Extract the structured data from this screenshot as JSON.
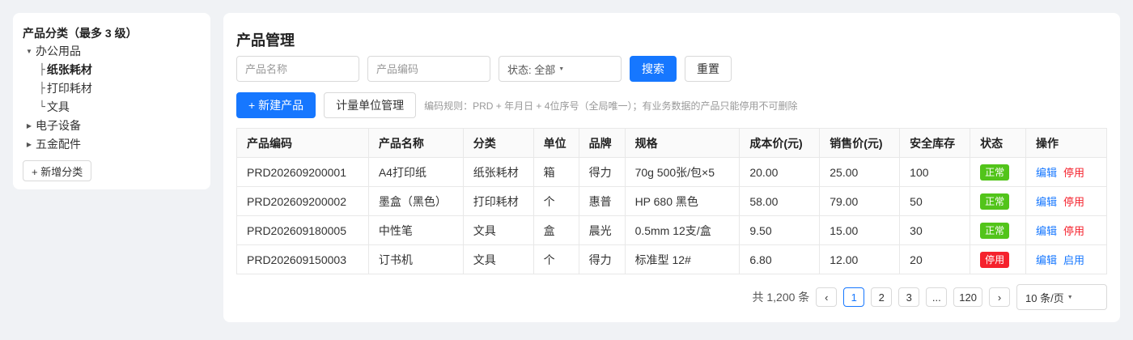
{
  "sidebar": {
    "title": "产品分类（最多 3 级）",
    "nodes": [
      {
        "label": "办公用品",
        "caret": "▼",
        "children": [
          {
            "branch": "├",
            "label": "纸张耗材"
          },
          {
            "branch": "├",
            "label": "打印耗材"
          },
          {
            "branch": "└",
            "label": "文具"
          }
        ]
      },
      {
        "label": "电子设备",
        "caret": "▶"
      },
      {
        "label": "五金配件",
        "caret": "▶"
      }
    ],
    "add_label": "+ 新增分类"
  },
  "main": {
    "title": "产品管理",
    "filters": {
      "name_placeholder": "产品名称",
      "code_placeholder": "产品编码",
      "status_label": "状态: 全部",
      "search_label": "搜索",
      "reset_label": "重置"
    },
    "actions": {
      "new_label": "+ 新建产品",
      "unit_label": "计量单位管理",
      "hint": "编码规则：PRD + 年月日 + 4位序号（全局唯一）；有业务数据的产品只能停用不可删除"
    },
    "table": {
      "headers": [
        "产品编码",
        "产品名称",
        "分类",
        "单位",
        "品牌",
        "规格",
        "成本价(元)",
        "销售价(元)",
        "安全库存",
        "状态",
        "操作"
      ],
      "rows": [
        {
          "code": "PRD202609200001",
          "name": "A4打印纸",
          "category": "纸张耗材",
          "unit": "箱",
          "brand": "得力",
          "spec": "70g 500张/包×5",
          "cost": "20.00",
          "price": "25.00",
          "stock": "100",
          "status": "正常",
          "edit": "编辑",
          "toggle": "停用"
        },
        {
          "code": "PRD202609200002",
          "name": "墨盒（黑色）",
          "category": "打印耗材",
          "unit": "个",
          "brand": "惠普",
          "spec": "HP 680 黑色",
          "cost": "58.00",
          "price": "79.00",
          "stock": "50",
          "status": "正常",
          "edit": "编辑",
          "toggle": "停用"
        },
        {
          "code": "PRD202609180005",
          "name": "中性笔",
          "category": "文具",
          "unit": "盒",
          "brand": "晨光",
          "spec": "0.5mm 12支/盒",
          "cost": "9.50",
          "price": "15.00",
          "stock": "30",
          "status": "正常",
          "edit": "编辑",
          "toggle": "停用"
        },
        {
          "code": "PRD202609150003",
          "name": "订书机",
          "category": "文具",
          "unit": "个",
          "brand": "得力",
          "spec": "标准型 12#",
          "cost": "6.80",
          "price": "12.00",
          "stock": "20",
          "status": "停用",
          "edit": "编辑",
          "toggle": "启用"
        }
      ]
    },
    "pagination": {
      "total": "共 1,200 条",
      "prev": "‹",
      "pages": [
        "1",
        "2",
        "3",
        "...",
        "120"
      ],
      "next": "›",
      "page_size": "10 条/页"
    }
  },
  "colors": {
    "primary": "#1677ff",
    "success": "#52c41a",
    "danger": "#f5222d"
  }
}
